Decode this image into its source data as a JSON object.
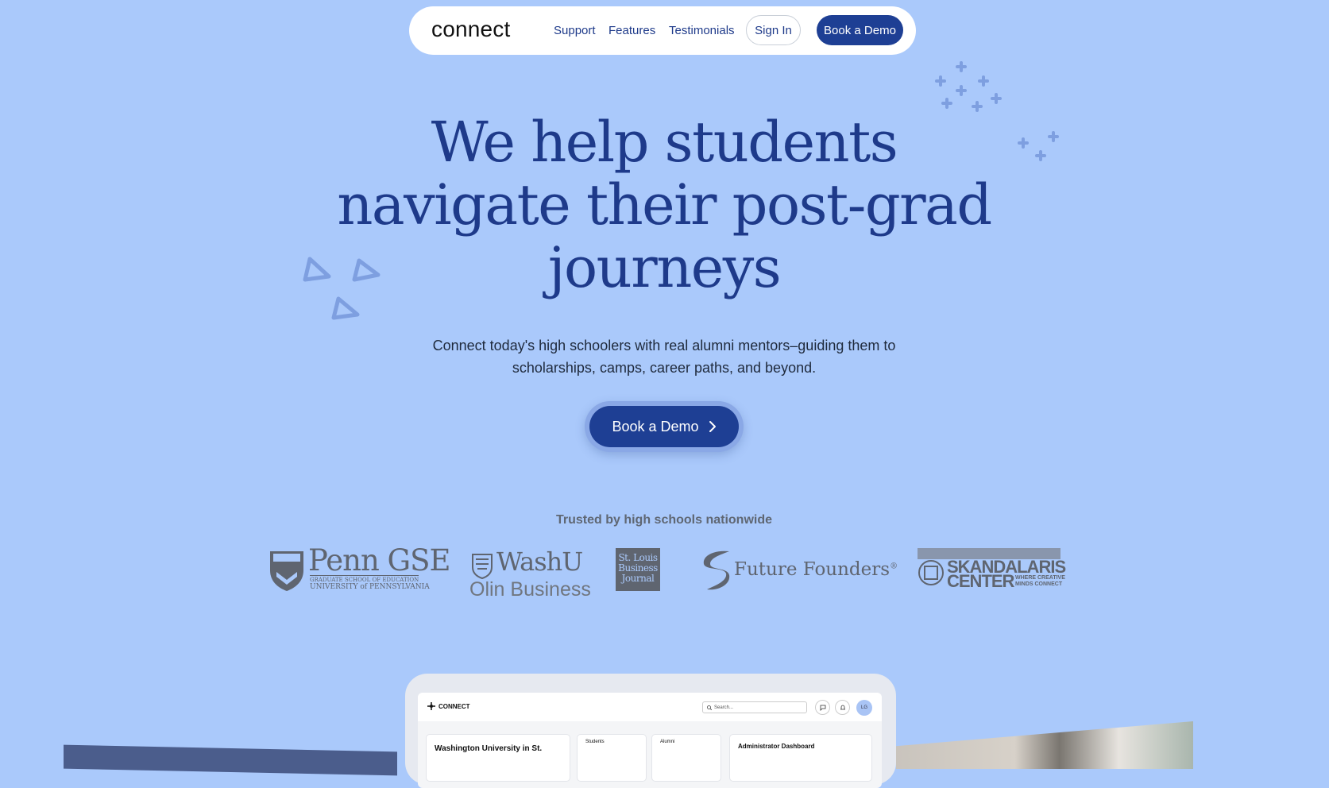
{
  "nav": {
    "logo": "connect",
    "links": [
      "Support",
      "Features",
      "Testimonials"
    ],
    "sign_in": "Sign In",
    "book_demo": "Book a Demo"
  },
  "hero": {
    "headline_lines": [
      "We help students",
      "navigate their post-grad",
      "journeys"
    ],
    "subtitle_lines": [
      "Connect today's high schoolers with real alumni mentors–guiding them to",
      "scholarships, camps, career paths, and beyond."
    ],
    "cta": "Book a Demo"
  },
  "trusted": {
    "heading": "Trusted by high schools nationwide",
    "logos": {
      "penn": {
        "name": "Penn GSE",
        "line1": "GRADUATE SCHOOL OF EDUCATION",
        "line2": "UNIVERSITY of PENNSYLVANIA"
      },
      "washu": {
        "name": "WashU",
        "line1": "Olin Business"
      },
      "stlbj": {
        "line1": "St. Louis",
        "line2": "Business",
        "line3": "Journal"
      },
      "future": {
        "name": "Future Founders",
        "mark": "®"
      },
      "skandalaris": {
        "line1": "SKANDALARIS",
        "line2": "CENTER",
        "tag1": "WHERE CREATIVE",
        "tag2": "MINDS CONNECT"
      }
    }
  },
  "app_preview": {
    "logo": "CONNECT",
    "search_placeholder": "Search...",
    "avatar": "LG",
    "cards": [
      "Washington University in St.",
      "Students",
      "Alumni",
      "Administrator Dashboard"
    ]
  },
  "colors": {
    "background": "#aac9fb",
    "primary": "#1e3f94",
    "heading": "#1e3a8a",
    "decoration": "#7e9fe0"
  }
}
